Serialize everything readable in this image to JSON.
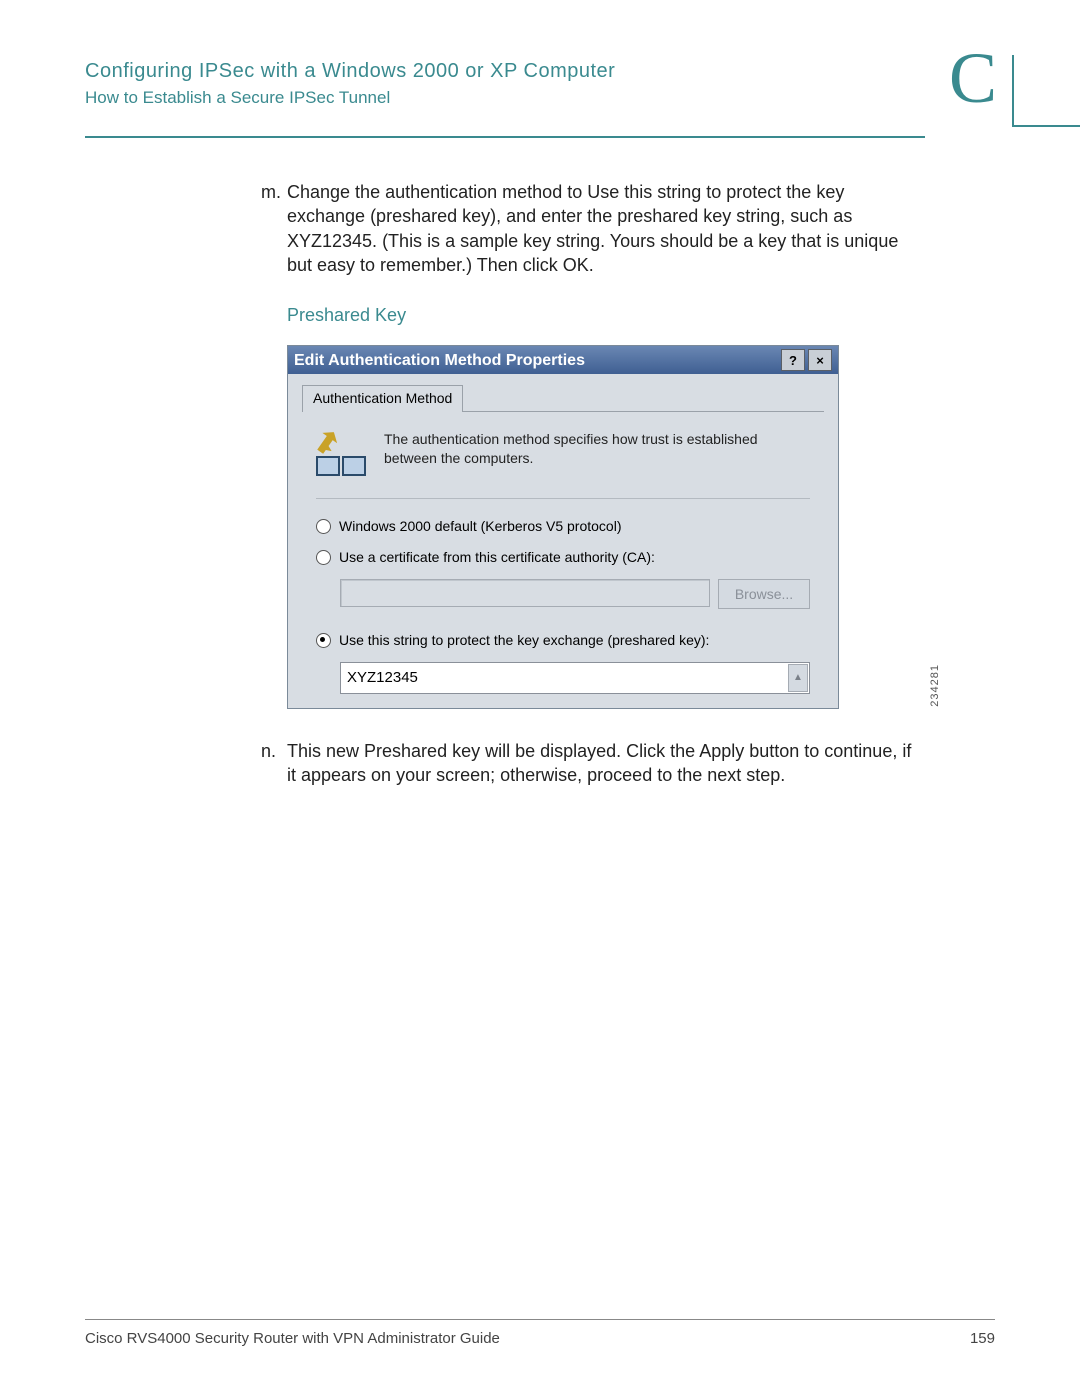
{
  "header": {
    "title": "Configuring IPSec with a Windows 2000 or XP Computer",
    "subtitle": "How to Establish a Secure IPSec Tunnel",
    "appendix_letter": "C"
  },
  "steps": {
    "m": {
      "marker": "m.",
      "text": "Change the authentication method to Use this string to protect the key exchange (preshared key), and enter the preshared key string, such as XYZ12345. (This is a sample key string. Yours should be a key that is unique but easy to remember.) Then click OK."
    },
    "n": {
      "marker": "n.",
      "text": "This new Preshared key will be displayed. Click the Apply button to continue, if it appears on your screen; otherwise, proceed to the next step."
    }
  },
  "caption": "Preshared Key",
  "dialog": {
    "title": "Edit Authentication Method Properties",
    "help_glyph": "?",
    "close_glyph": "×",
    "tab_label": "Authentication Method",
    "info_text": "The authentication method specifies how trust is established between the computers.",
    "opt_kerberos": "Windows 2000 default (Kerberos V5 protocol)",
    "opt_cert": "Use a certificate from this certificate authority (CA):",
    "browse_label": "Browse...",
    "opt_psk": "Use this string to protect the key exchange (preshared key):",
    "psk_value": "XYZ12345",
    "scroll_glyph": "▲"
  },
  "figure_ref": "234281",
  "footer": {
    "left": "Cisco RVS4000 Security Router with VPN Administrator Guide",
    "page": "159"
  }
}
